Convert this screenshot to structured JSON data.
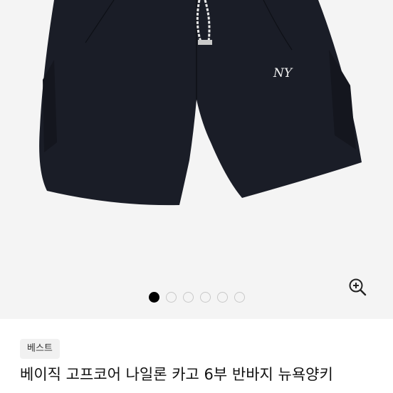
{
  "gallery": {
    "image_alt": "NY logo navy nylon cargo shorts",
    "logo_text": "NY",
    "zoom_icon": "zoom-in-icon",
    "page_count": 6,
    "active_page": 1
  },
  "product": {
    "badge": "베스트",
    "title": "베이직 고프코어 나일론 카고 6부 반바지 뉴욕양키"
  },
  "colors": {
    "shorts": "#1a1d27",
    "background": "#f4f4f4",
    "dot_active": "#000000",
    "dot_inactive": "#c8c8c8",
    "badge_bg": "#f1f1f1"
  }
}
